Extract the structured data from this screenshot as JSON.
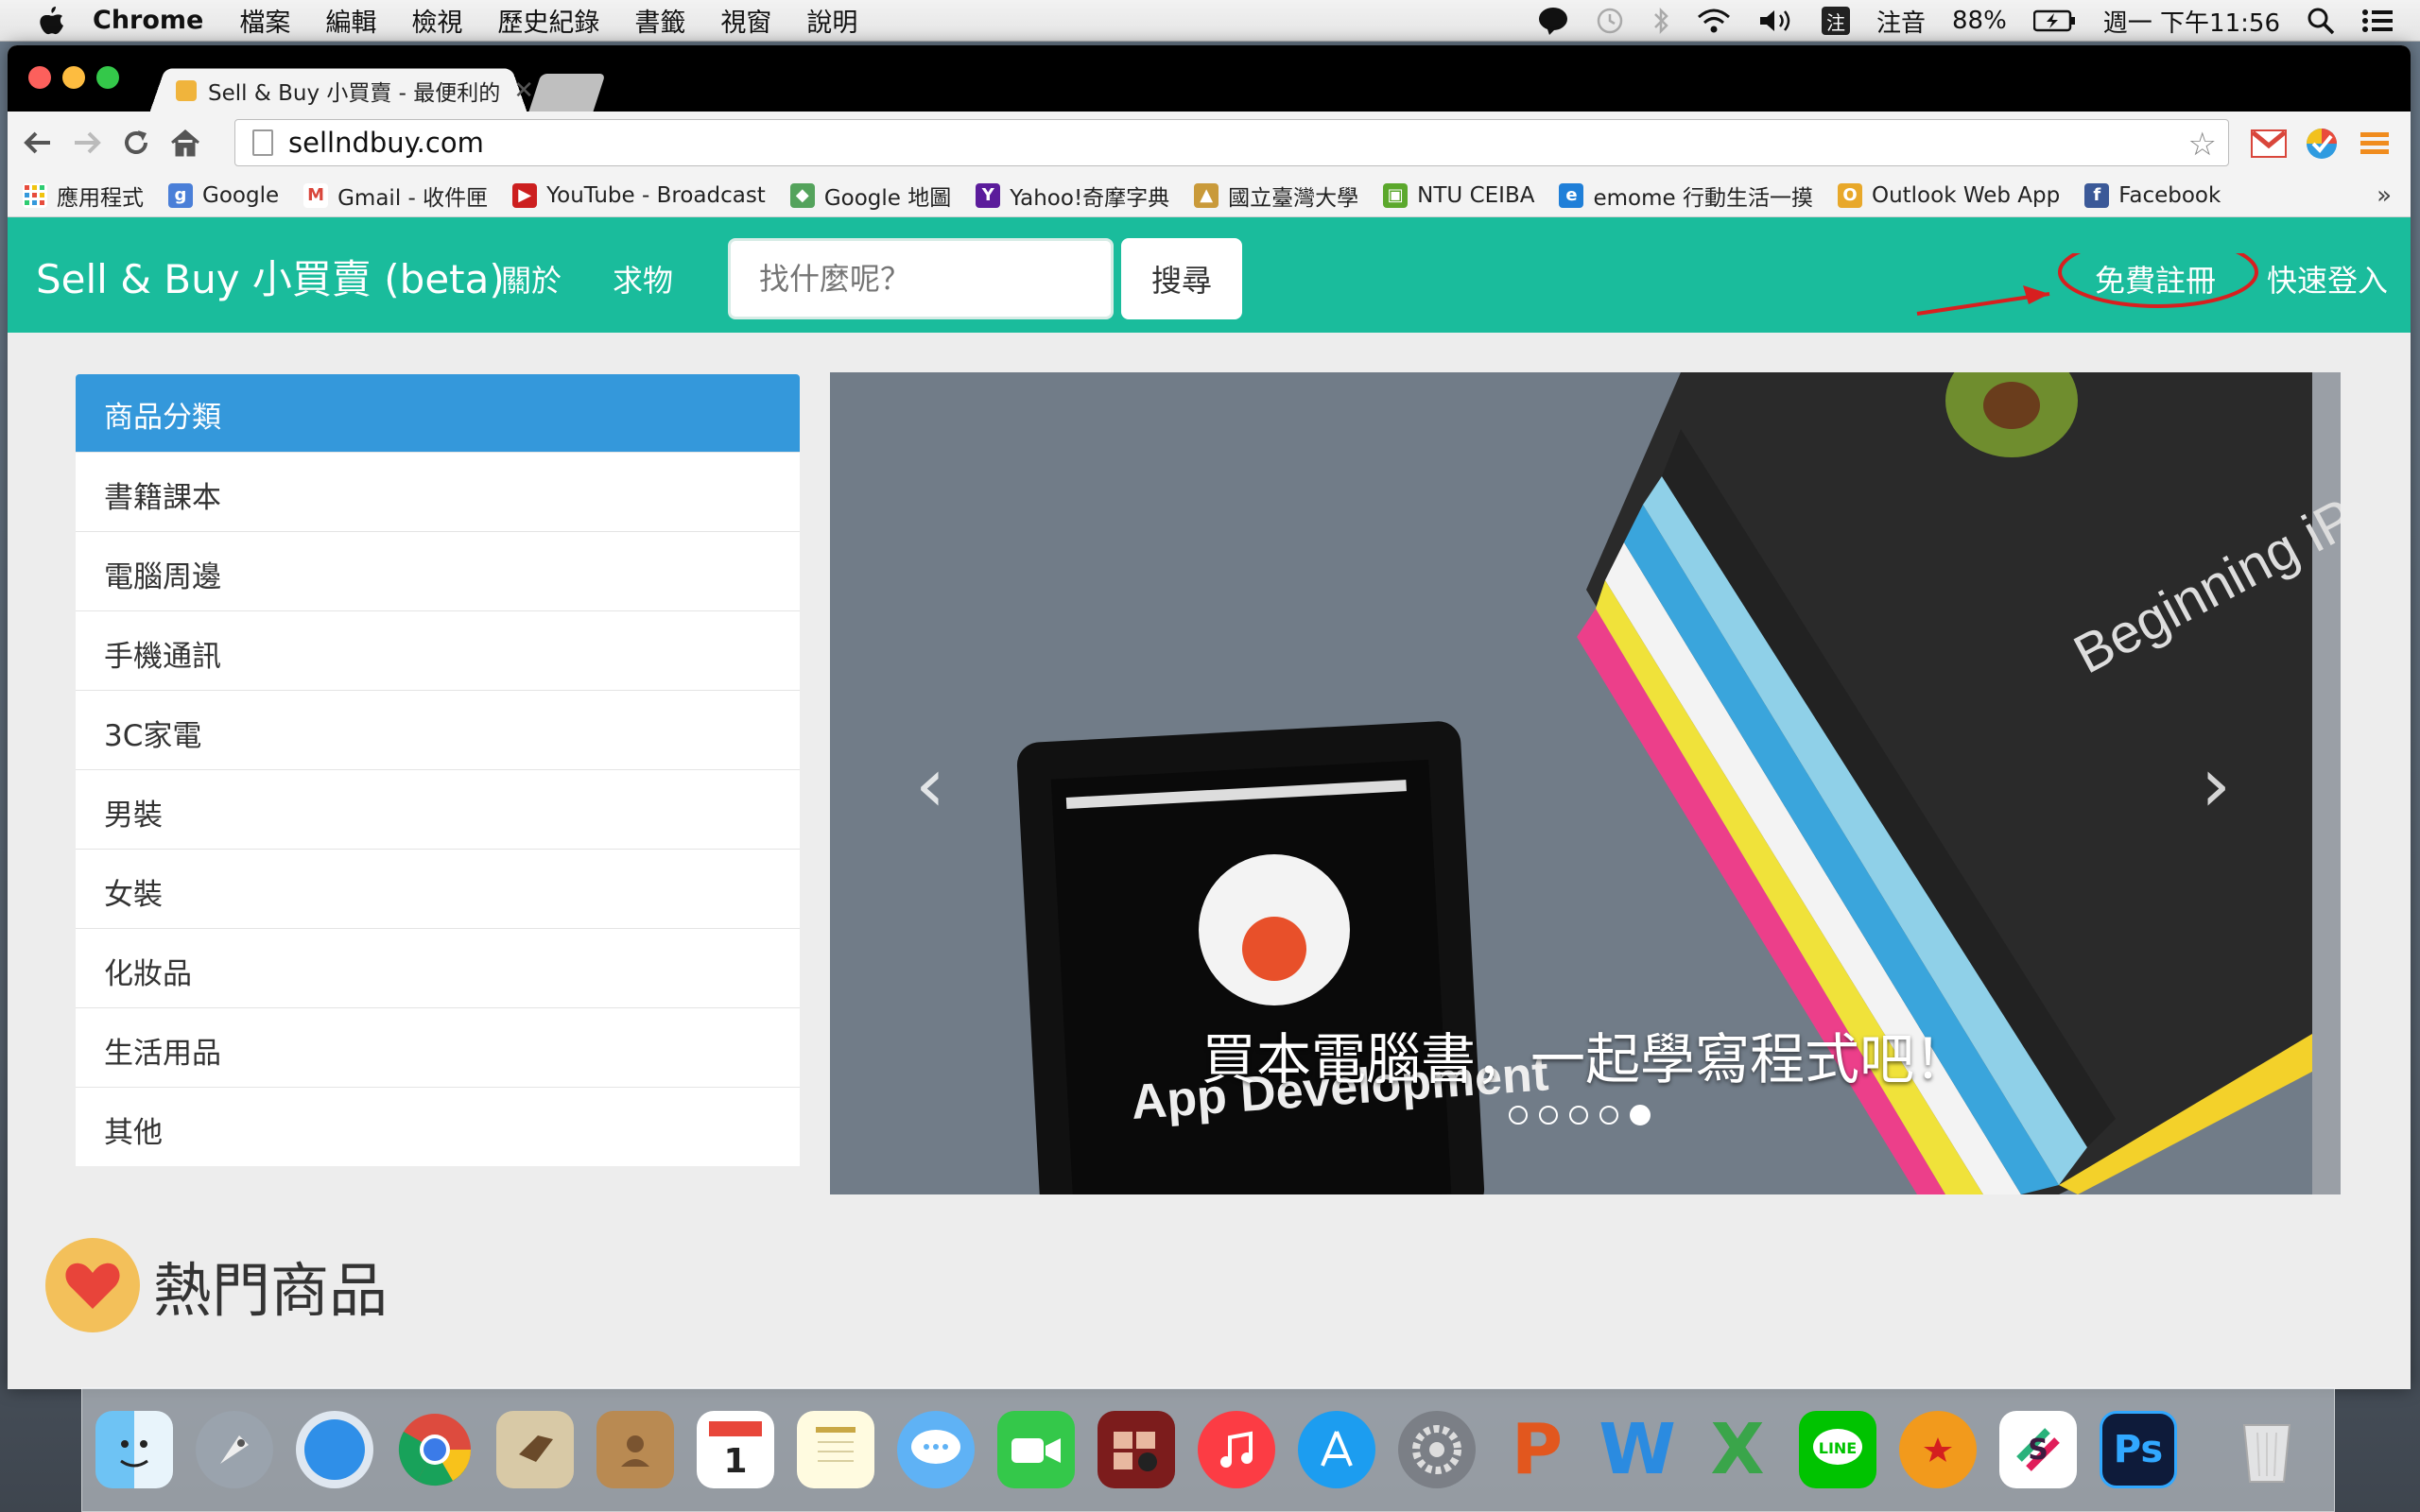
{
  "menubar": {
    "app_name": "Chrome",
    "items": [
      "檔案",
      "編輯",
      "檢視",
      "歷史紀錄",
      "書籤",
      "視窗",
      "說明"
    ],
    "input_method": "注音",
    "input_badge": "注",
    "battery": "88%",
    "clock": "週一 下午11:56"
  },
  "browser": {
    "tab_title": "Sell & Buy 小買賣 - 最便利的",
    "tab_close": "✕",
    "url": "sellndbuy.com"
  },
  "bookmarks": [
    {
      "label": "應用程式",
      "icon": "apps-grid-icon",
      "color": "#e74c3c"
    },
    {
      "label": "Google",
      "icon": "google-icon",
      "color": "#4a7fd8"
    },
    {
      "label": "Gmail - 收件匣",
      "icon": "gmail-icon",
      "color": "#d9463b"
    },
    {
      "label": "YouTube - Broadcast",
      "icon": "youtube-icon",
      "color": "#cc1f1f"
    },
    {
      "label": "Google 地圖",
      "icon": "maps-icon",
      "color": "#54a35c"
    },
    {
      "label": "Yahoo!奇摩字典",
      "icon": "yahoo-icon",
      "color": "#5b1c9b"
    },
    {
      "label": "國立臺灣大學",
      "icon": "ntu-icon",
      "color": "#c99a3a"
    },
    {
      "label": "NTU CEIBA",
      "icon": "ceiba-icon",
      "color": "#5ba82c"
    },
    {
      "label": "emome 行動生活一摸",
      "icon": "emome-icon",
      "color": "#1f7fd8"
    },
    {
      "label": "Outlook Web App",
      "icon": "outlook-icon",
      "color": "#e8a82a"
    },
    {
      "label": "Facebook",
      "icon": "facebook-icon",
      "color": "#3b5998"
    }
  ],
  "bookmarks_more": "»",
  "site": {
    "brand": "Sell & Buy 小買賣 (beta)",
    "nav_about": "關於",
    "nav_request": "求物",
    "search_placeholder": "找什麼呢？",
    "search_button": "搜尋",
    "register": "免費註冊",
    "login": "快速登入",
    "accent": "#1abc9c"
  },
  "categories": {
    "heading": "商品分類",
    "items": [
      "書籍課本",
      "電腦周邊",
      "手機通訊",
      "3C家電",
      "男裝",
      "女裝",
      "化妝品",
      "生活用品",
      "其他"
    ]
  },
  "carousel": {
    "caption": "買本電腦書，一起學寫程式吧！",
    "slide_count": 5,
    "active_slide": 5,
    "book_title": "Beginning iPhone Games Development",
    "ipad_title": "App Development"
  },
  "hot": {
    "title": "熱門商品"
  }
}
